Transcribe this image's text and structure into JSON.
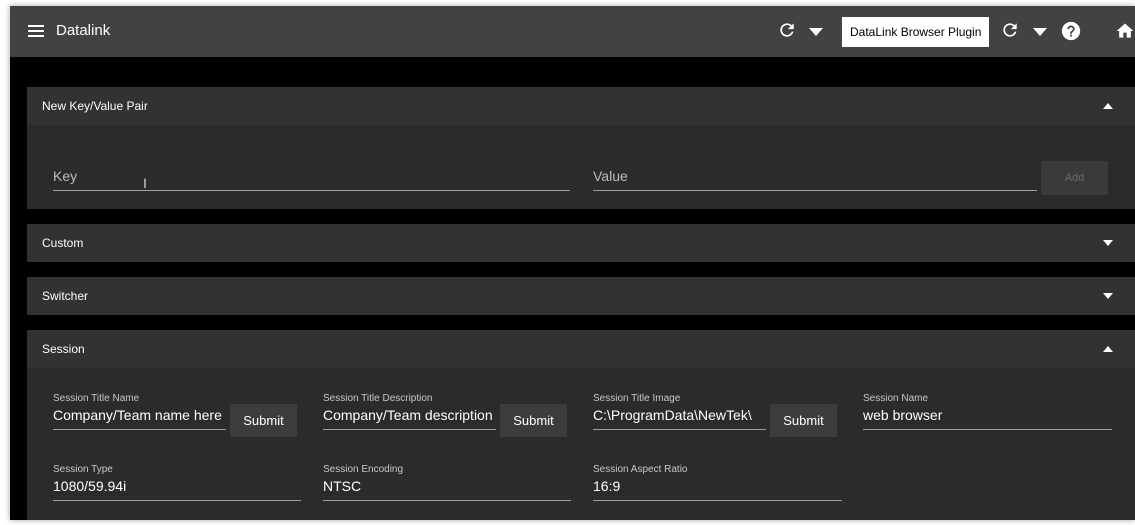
{
  "app": {
    "title": "Datalink",
    "plugin_button": "DataLink Browser Plugin"
  },
  "panels": {
    "new_pair": {
      "title": "New Key/Value Pair",
      "key_placeholder": "Key",
      "value_placeholder": "Value",
      "add_label": "Add"
    },
    "custom": {
      "title": "Custom"
    },
    "switcher": {
      "title": "Switcher"
    },
    "session": {
      "title": "Session",
      "submit_label": "Submit",
      "title_name": {
        "label": "Session Title Name",
        "value": "Company/Team name here"
      },
      "title_description": {
        "label": "Session Title Description",
        "value": "Company/Team description"
      },
      "title_image": {
        "label": "Session Title Image",
        "value": "C:\\ProgramData\\NewTek\\"
      },
      "name": {
        "label": "Session Name",
        "value": "web browser"
      },
      "type": {
        "label": "Session Type",
        "value": "1080/59.94i"
      },
      "encoding": {
        "label": "Session Encoding",
        "value": "NTSC"
      },
      "aspect_ratio": {
        "label": "Session Aspect Ratio",
        "value": "16:9"
      }
    }
  },
  "icons": {
    "menu": "menu-icon",
    "refresh": "refresh-icon",
    "dropdown": "caret-down-icon",
    "help": "help-icon",
    "home": "home-icon"
  }
}
